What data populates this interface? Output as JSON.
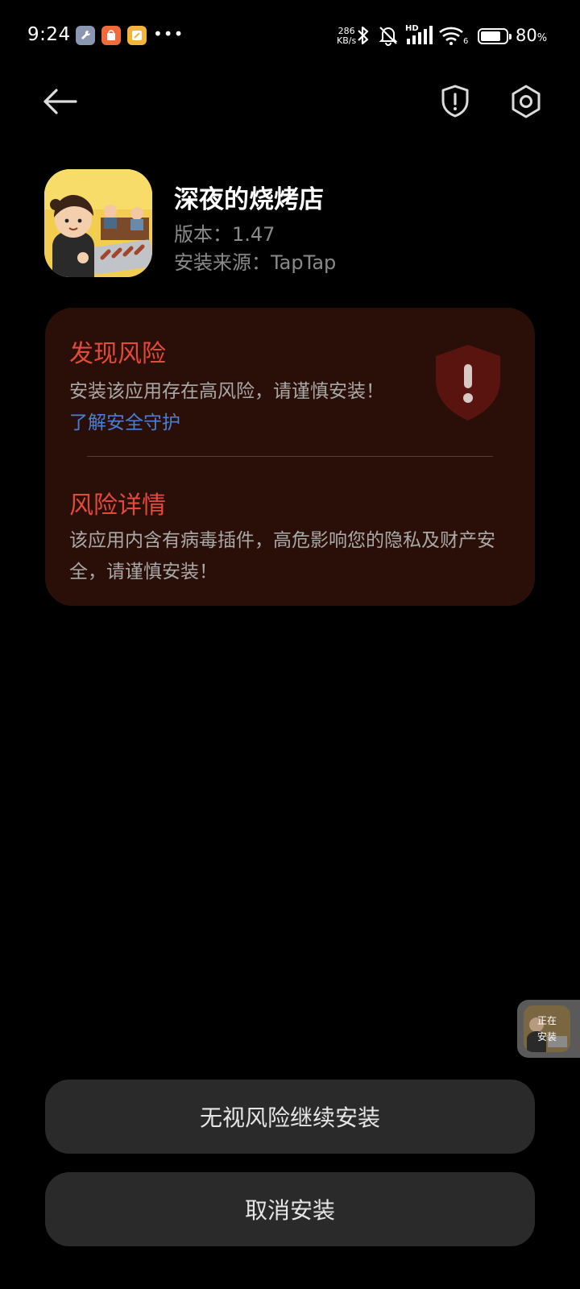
{
  "status_bar": {
    "time": "9:24",
    "more": "•••",
    "net_speed_value": "286",
    "net_speed_unit": "KB/s",
    "hd_label": "HD",
    "wifi_badge": "6",
    "battery_percent": "80",
    "battery_unit": "%",
    "battery_level": 0.8
  },
  "toolbar": {
    "back_icon": "arrow-left-icon",
    "shield_icon": "shield-exclamation-icon",
    "settings_icon": "gear-icon"
  },
  "app": {
    "name": "深夜的烧烤店",
    "version": "版本：1.47",
    "source": "安装来源：TapTap"
  },
  "risk": {
    "title": "发现风险",
    "description": "安装该应用存在高风险，请谨慎安装！",
    "learn_more": "了解安全守护",
    "detail_title": "风险详情",
    "detail_description": "该应用内含有病毒插件，高危影响您的隐私及财产安全，请谨慎安装！"
  },
  "install_bubble": {
    "label_line1": "正在",
    "label_line2": "安装"
  },
  "buttons": {
    "continue_label": "无视风险继续安装",
    "cancel_label": "取消安装"
  },
  "colors": {
    "risk_red": "#e24a3a",
    "card_bg": "#2a0f08",
    "link_blue": "#4a7fd8",
    "button_bg": "#2a2a2a"
  }
}
